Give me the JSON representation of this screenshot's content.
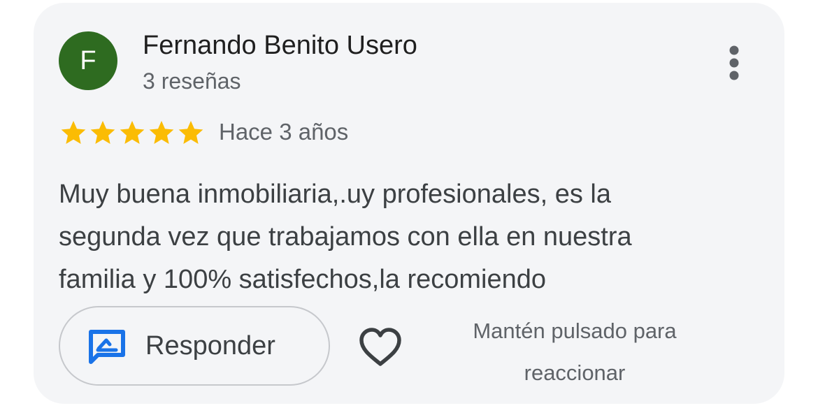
{
  "review": {
    "author_initial": "F",
    "author_name": "Fernando Benito Usero",
    "review_count": "3 reseñas",
    "rating": 5,
    "rating_max": 5,
    "date": "Hace 3 años",
    "text_lines": [
      "Muy buena inmobiliaria,.uy profesionales, es la",
      "segunda vez que trabajamos con ella en nuestra",
      "familia y 100% satisfechos,la recomiendo"
    ]
  },
  "actions": {
    "reply_label": "Responder",
    "react_hint_lines": [
      "Mantén pulsado para",
      "reaccionar"
    ]
  },
  "icons": {
    "more": "more-vert-icon",
    "star": "star-icon",
    "reply": "reply-icon",
    "heart": "heart-icon"
  },
  "colors": {
    "card_bg": "#f4f5f7",
    "avatar_bg": "#2e6b20",
    "star": "#fbbc04",
    "reply_icon": "#1a73e8",
    "text_primary": "#1f1f1f",
    "text_secondary": "#5f6368"
  }
}
